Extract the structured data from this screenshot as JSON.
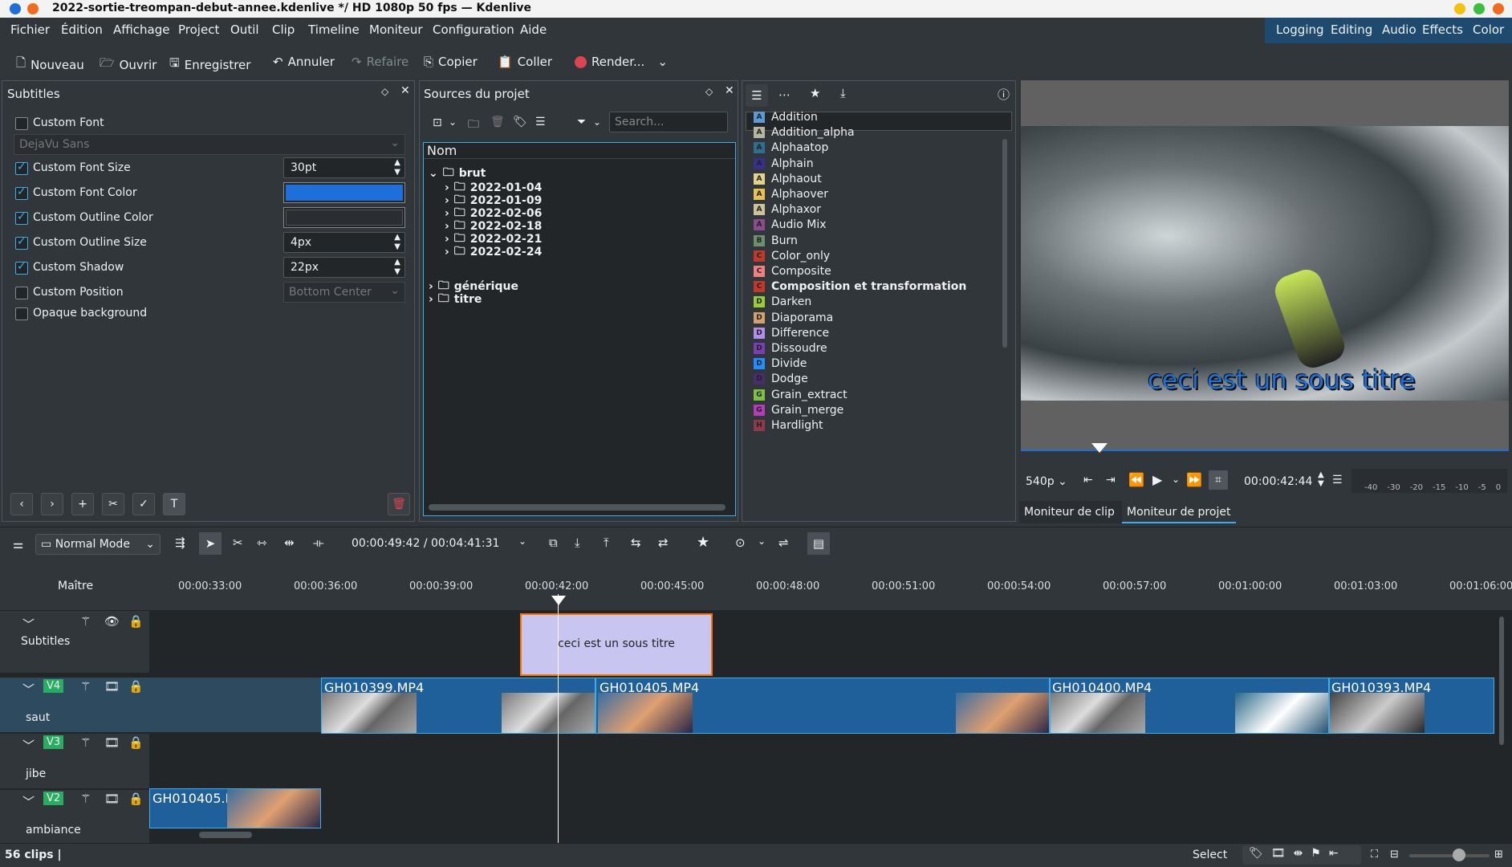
{
  "window": {
    "title": "2022-sortie-treompan-debut-annee.kdenlive */ HD 1080p 50 fps — Kdenlive"
  },
  "menu": [
    "Fichier",
    "Édition",
    "Affichage",
    "Project",
    "Outil",
    "Clip",
    "Timeline",
    "Moniteur",
    "Configuration",
    "Aide"
  ],
  "layouts": [
    "Logging",
    "Editing",
    "Audio",
    "Effects",
    "Color"
  ],
  "toolbar": {
    "new": "Nouveau",
    "open": "Ouvrir",
    "save": "Enregistrer",
    "undo": "Annuler",
    "redo": "Refaire",
    "copy": "Copier",
    "paste": "Coller",
    "render": "Render..."
  },
  "subtitles": {
    "title": "Subtitles",
    "custom_font": "Custom Font",
    "font_value": "DejaVu Sans",
    "font_size_label": "Custom Font Size",
    "font_size": "30pt",
    "font_color_label": "Custom Font Color",
    "outline_color_label": "Custom Outline Color",
    "outline_size_label": "Custom Outline Size",
    "outline_size": "4px",
    "shadow_label": "Custom Shadow",
    "shadow": "22px",
    "position_label": "Custom Position",
    "position": "Bottom Center",
    "opaque_label": "Opaque background",
    "font_color": "#1e6fd9"
  },
  "sources": {
    "title": "Sources du projet",
    "search_placeholder": "Search...",
    "col": "Nom",
    "root": "brut",
    "children": [
      "2022-01-04",
      "2022-01-09",
      "2022-02-06",
      "2022-02-18",
      "2022-02-21",
      "2022-02-24"
    ],
    "others": [
      "générique",
      "titre"
    ]
  },
  "effects": [
    {
      "n": "Addition",
      "c": "#5b9bd5",
      "l": "A"
    },
    {
      "n": "Addition_alpha",
      "c": "#b5b5a0",
      "l": "A"
    },
    {
      "n": "Alphaatop",
      "c": "#2e6e8e",
      "l": "A"
    },
    {
      "n": "Alphain",
      "c": "#3a2f8e",
      "l": "A"
    },
    {
      "n": "Alphaout",
      "c": "#e0d38c",
      "l": "A"
    },
    {
      "n": "Alphaover",
      "c": "#e8c24f",
      "l": "A"
    },
    {
      "n": "Alphaxor",
      "c": "#c9c29a",
      "l": "A"
    },
    {
      "n": "Audio Mix",
      "c": "#8e4a8e",
      "l": "A"
    },
    {
      "n": "Burn",
      "c": "#6e8e6e",
      "l": "B"
    },
    {
      "n": "Color_only",
      "c": "#c0392b",
      "l": "C"
    },
    {
      "n": "Composite",
      "c": "#f08080",
      "l": "C"
    },
    {
      "n": "Composition et transformation",
      "c": "#c0392b",
      "l": "C"
    },
    {
      "n": "Darken",
      "c": "#9acd32",
      "l": "D"
    },
    {
      "n": "Diaporama",
      "c": "#d2a26e",
      "l": "D"
    },
    {
      "n": "Difference",
      "c": "#b28ee8",
      "l": "D"
    },
    {
      "n": "Dissoudre",
      "c": "#7b3fb5",
      "l": "D"
    },
    {
      "n": "Divide",
      "c": "#1e90ff",
      "l": "D"
    },
    {
      "n": "Dodge",
      "c": "#4b2a6e",
      "l": "D"
    },
    {
      "n": "Grain_extract",
      "c": "#7cc142",
      "l": "G"
    },
    {
      "n": "Grain_merge",
      "c": "#b03fb5",
      "l": "G"
    },
    {
      "n": "Hardlight",
      "c": "#8e3a4a",
      "l": "H"
    }
  ],
  "monitor": {
    "subtitle": "ceci est un sous titre",
    "resolution": "540p",
    "timecode": "00:00:42:44",
    "db_labels": [
      "-40",
      "-30",
      "-20",
      "-15",
      "-10",
      "-5",
      "0"
    ],
    "tab_clip": "Moniteur de clip",
    "tab_project": "Moniteur de projet"
  },
  "timeline": {
    "mode": "Normal Mode",
    "position": "00:00:49:42 / 00:04:41:31",
    "master": "Maître",
    "ticks": [
      "00:00:33:00",
      "00:00:36:00",
      "00:00:39:00",
      "00:00:42:00",
      "00:00:45:00",
      "00:00:48:00",
      "00:00:51:00",
      "00:00:54:00",
      "00:00:57:00",
      "00:01:00:00",
      "00:01:03:00",
      "00:01:06:00"
    ],
    "subtitle_track": "Subtitles",
    "subtitle_clip": "ceci est un sous titre",
    "tracks": [
      {
        "tag": "V4",
        "name": "saut"
      },
      {
        "tag": "V3",
        "name": "jibe"
      },
      {
        "tag": "V2",
        "name": "ambiance"
      }
    ],
    "clips": [
      "GH010399.MP4",
      "GH010405.MP4",
      "GH010400.MP4",
      "GH010393.MP4",
      "GH010405.MP4"
    ]
  },
  "status": {
    "clips": "56 clips |",
    "tool": "Select"
  }
}
